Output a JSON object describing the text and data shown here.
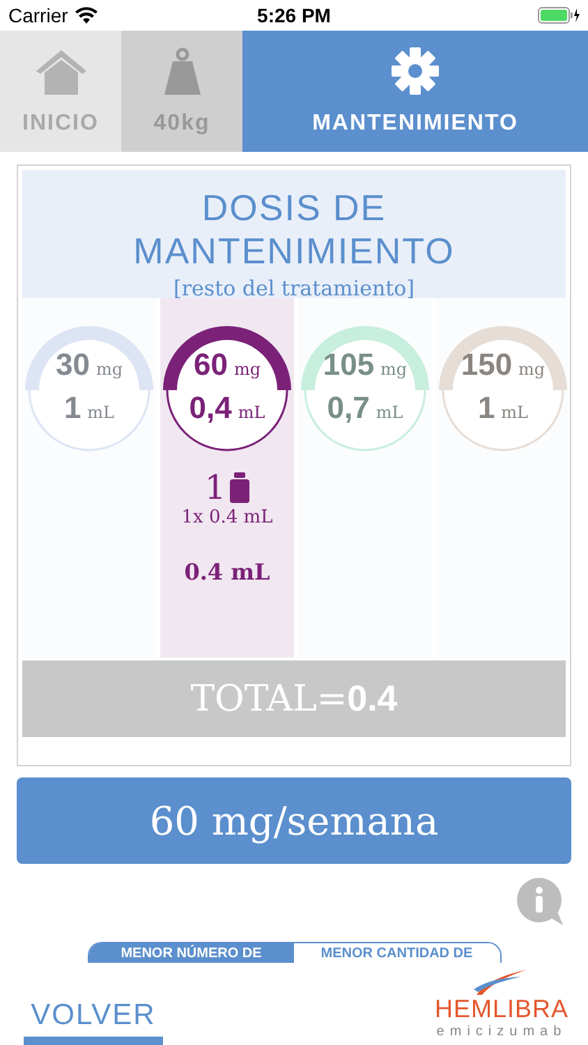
{
  "status_bar": {
    "carrier": "Carrier",
    "time": "5:26 PM"
  },
  "tabs": [
    {
      "kind": "home",
      "label": "INICIO",
      "selected": false
    },
    {
      "kind": "weight",
      "label": "40kg",
      "selected": false
    },
    {
      "kind": "gear",
      "label": "MANTENIMIENTO",
      "selected": true
    }
  ],
  "card": {
    "title": "DOSIS DE MANTENIMIENTO",
    "subtitle": "[resto del tratamiento]",
    "doses": [
      {
        "mg": "30",
        "mg_unit": "mg",
        "ml": "1",
        "ml_unit": "mL",
        "color": "#dde5f4",
        "selected": false
      },
      {
        "mg": "60",
        "mg_unit": "mg",
        "ml": "0,4",
        "ml_unit": "mL",
        "color": "#7b2278",
        "selected": true,
        "vials": "1",
        "vial_detail": "1x 0.4 mL",
        "volume": "0.4 mL"
      },
      {
        "mg": "105",
        "mg_unit": "mg",
        "ml": "0,7",
        "ml_unit": "mL",
        "color": "#c8eedd",
        "selected": false
      },
      {
        "mg": "150",
        "mg_unit": "mg",
        "ml": "1",
        "ml_unit": "mL",
        "color": "#e6ddd6",
        "selected": false
      }
    ],
    "total_label": "TOTAL=",
    "total_value": "0.4"
  },
  "dose_button": "60 mg/semana",
  "segments": [
    {
      "label": "MENOR NÚMERO DE",
      "selected": true
    },
    {
      "label": "MENOR CANTIDAD DE",
      "selected": false
    }
  ],
  "back_button": "VOLVER",
  "logo": {
    "name": "HEMLIBRA",
    "subtitle": "emicizumab"
  }
}
